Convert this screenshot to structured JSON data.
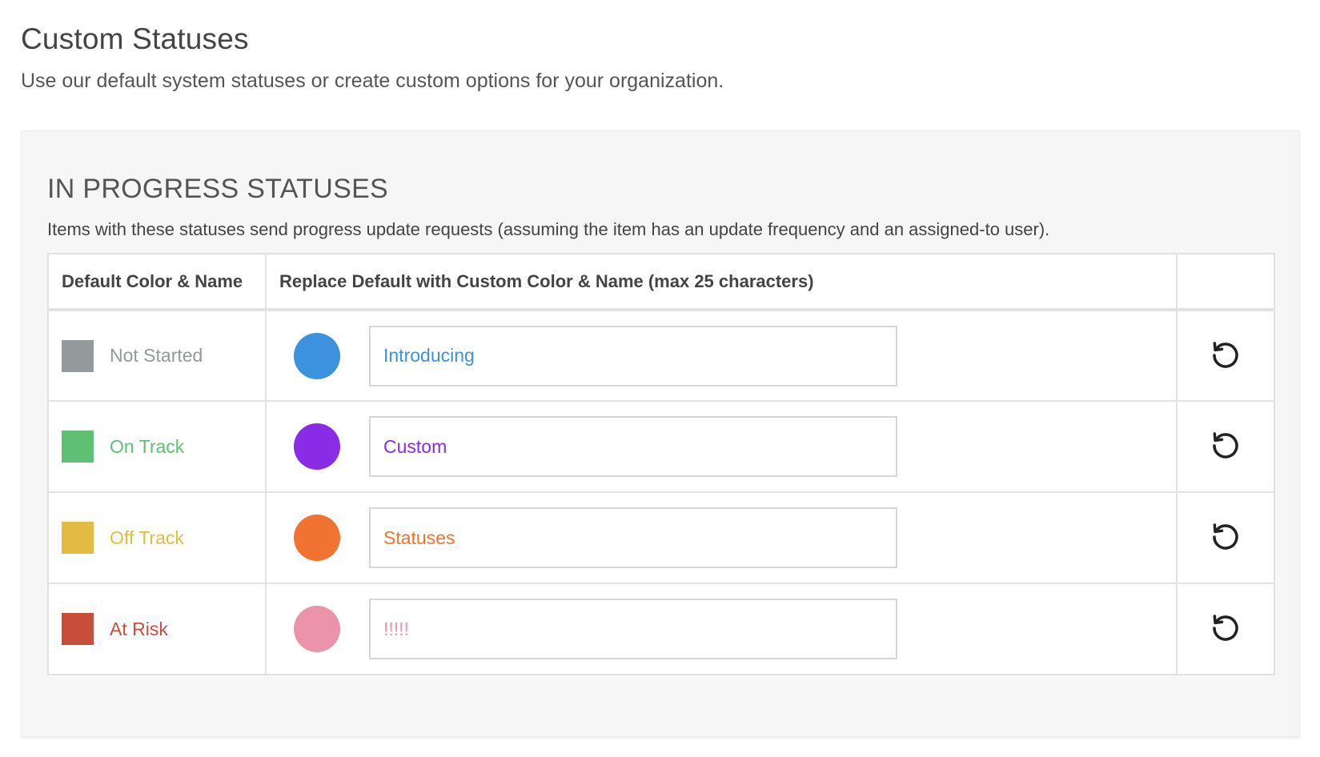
{
  "header": {
    "title": "Custom Statuses",
    "subtitle": "Use our default system statuses or create custom options for your organization."
  },
  "section": {
    "title": "IN PROGRESS STATUSES",
    "description": "Items with these statuses send progress update requests (assuming the item has an update frequency and an assigned-to user)."
  },
  "table": {
    "headers": {
      "default": "Default Color & Name",
      "custom": "Replace Default with Custom Color & Name (max 25 characters)",
      "reset": ""
    },
    "rows": [
      {
        "default_name": "Not Started",
        "default_color": "#939a9b",
        "custom_color": "#3d92dd",
        "custom_value": "Introducing",
        "reset_icon": "reset-icon"
      },
      {
        "default_name": "On Track",
        "default_color": "#5fbf72",
        "custom_color": "#8a2be6",
        "custom_value": "Custom",
        "reset_icon": "reset-icon"
      },
      {
        "default_name": "Off Track",
        "default_color": "#e3bb40",
        "custom_color": "#f07331",
        "custom_value": "Statuses",
        "reset_icon": "reset-icon"
      },
      {
        "default_name": "At Risk",
        "default_color": "#c94d3b",
        "custom_color": "#ea93a9",
        "custom_value": "!!!!!",
        "reset_icon": "reset-icon"
      }
    ]
  }
}
